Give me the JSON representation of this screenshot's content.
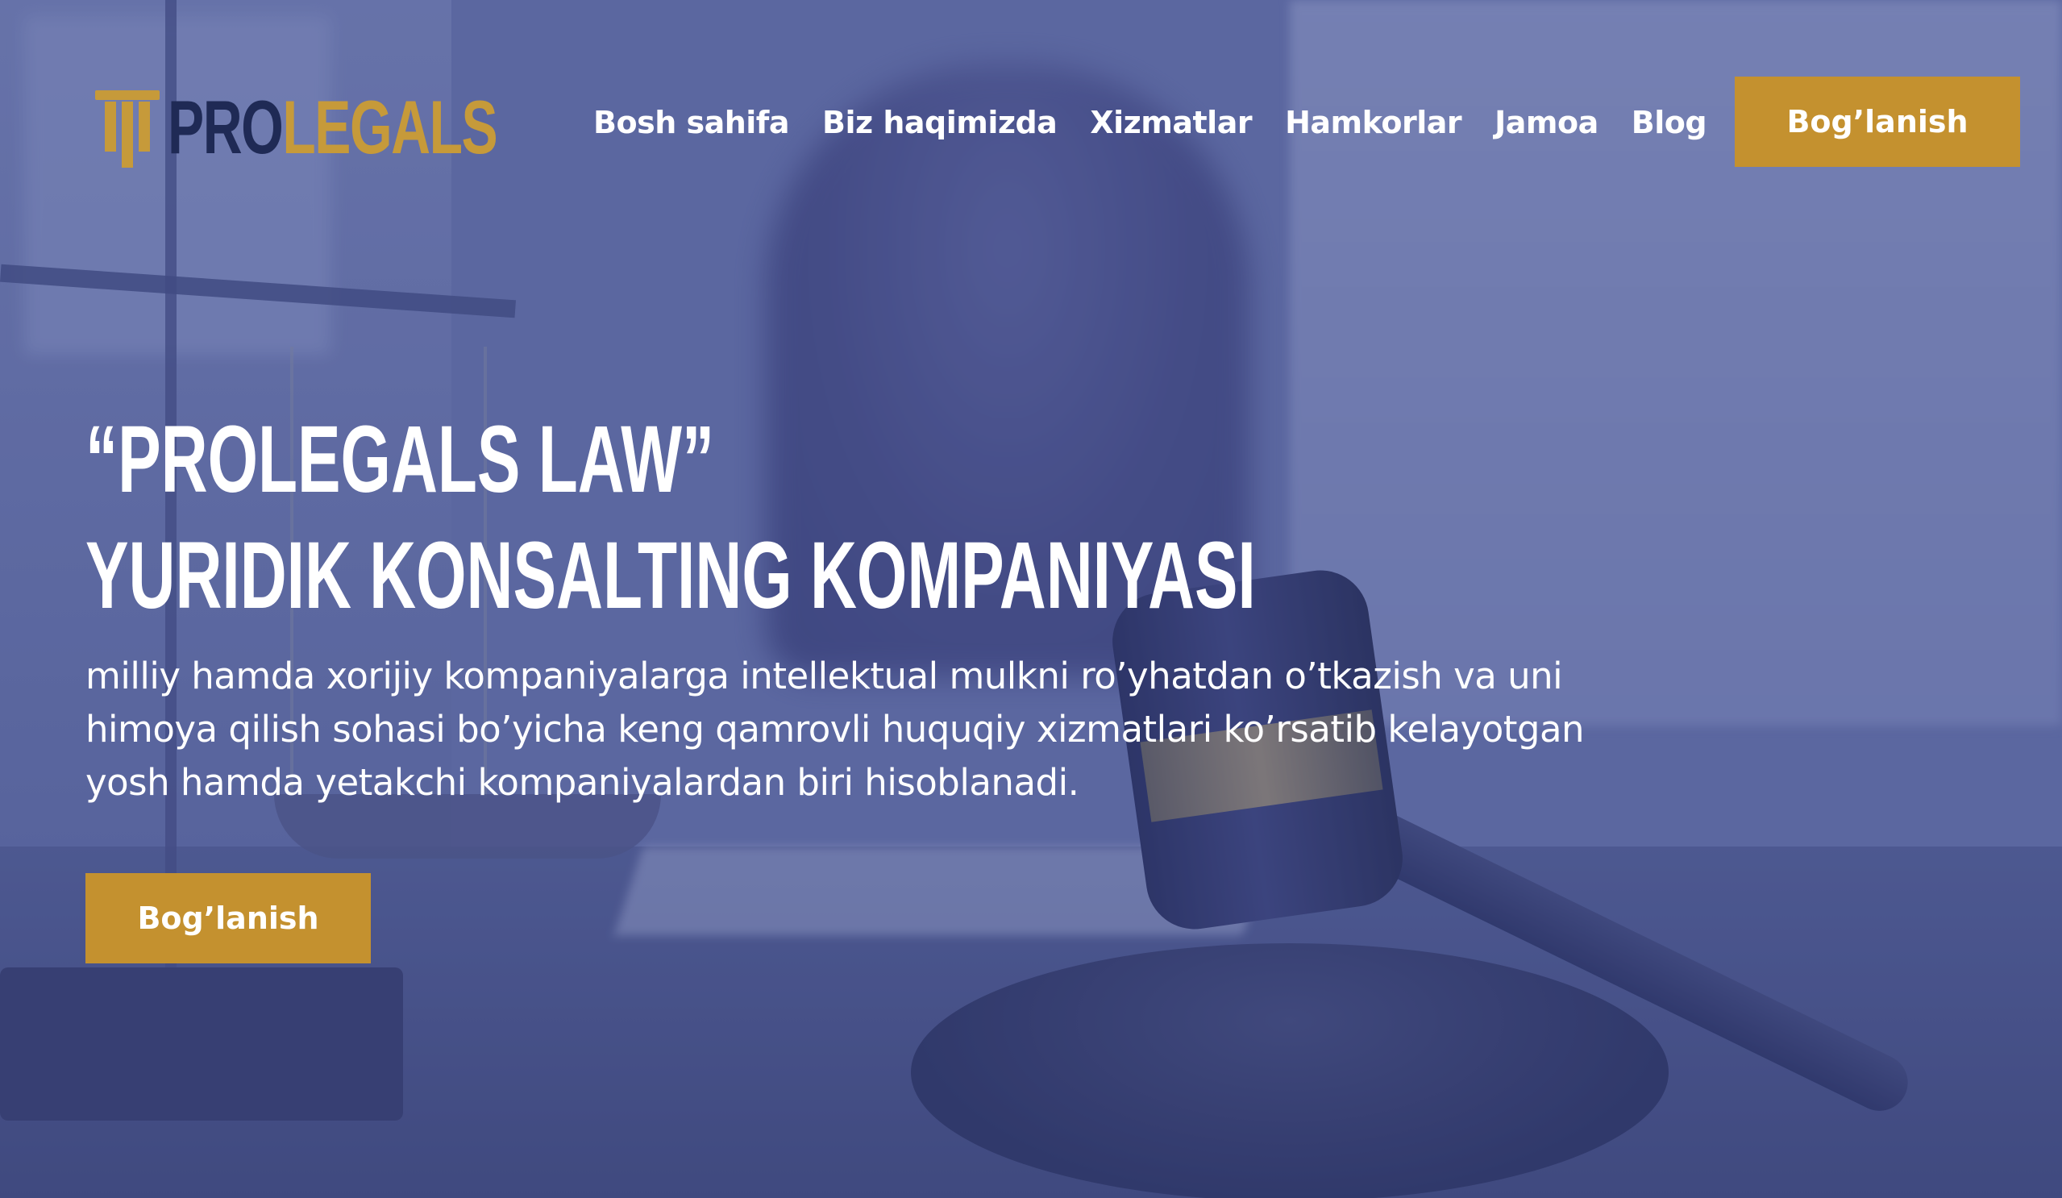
{
  "brand": {
    "name_part1": "PRO",
    "name_part2": "LEGALS",
    "colors": {
      "navy": "#1f2a55",
      "gold": "#c4912f"
    }
  },
  "nav": {
    "items": [
      {
        "label": "Bosh sahifa"
      },
      {
        "label": "Biz haqimizda"
      },
      {
        "label": "Xizmatlar"
      },
      {
        "label": "Hamkorlar"
      },
      {
        "label": "Jamoa"
      },
      {
        "label": "Blog"
      }
    ],
    "cta_label": "Bog’lanish"
  },
  "hero": {
    "title_line1": "“PROLEGALS LAW”",
    "title_line2": "YURIDIK KONSALTING KOMPANIYASI",
    "desc_lines": [
      "milliy hamda xorijiy kompaniyalarga intellektual mulkni ro’yhatdan o’tkazish va uni",
      "himoya qilish sohasi bo’yicha keng qamrovli huquqiy xizmatlari ko’rsatib kelayotgan",
      "yosh hamda yetakchi kompaniyalardan biri hisoblanadi."
    ],
    "cta_label": "Bog’lanish",
    "overlay_color": "#4a5696"
  }
}
